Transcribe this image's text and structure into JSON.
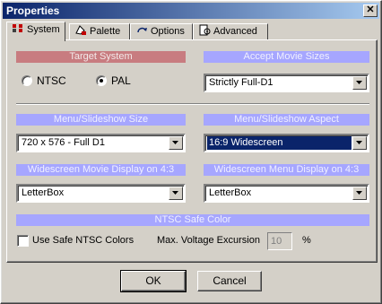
{
  "window": {
    "title": "Properties",
    "close_glyph": "✕"
  },
  "tabs": [
    {
      "label": "System",
      "icon": "system-icon",
      "active": true
    },
    {
      "label": "Palette",
      "icon": "palette-icon",
      "active": false
    },
    {
      "label": "Options",
      "icon": "options-icon",
      "active": false
    },
    {
      "label": "Advanced",
      "icon": "advanced-icon",
      "active": false
    }
  ],
  "target_system": {
    "header": "Target System",
    "ntsc_label": "NTSC",
    "pal_label": "PAL",
    "selected": "PAL"
  },
  "accept_movie_sizes": {
    "header": "Accept Movie Sizes",
    "value": "Strictly Full-D1"
  },
  "menu_size": {
    "header": "Menu/Slideshow Size",
    "value": "720 x 576 - Full D1"
  },
  "menu_aspect": {
    "header": "Menu/Slideshow Aspect",
    "value": "16:9 Widescreen"
  },
  "widescreen_movie": {
    "header": "Widescreen Movie Display on 4:3",
    "value": "LetterBox"
  },
  "widescreen_menu": {
    "header": "Widescreen Menu Display on 4:3",
    "value": "LetterBox"
  },
  "ntsc_safe": {
    "header": "NTSC Safe Color",
    "checkbox_label": "Use Safe NTSC Colors",
    "checked": false,
    "voltage_label": "Max. Voltage Excursion",
    "voltage_value": "10",
    "voltage_unit": "%"
  },
  "buttons": {
    "ok": "OK",
    "cancel": "Cancel"
  },
  "colors": {
    "title_start": "#0a246a",
    "title_end": "#a6caf0",
    "header_red": "#c87c80",
    "header_blue": "#a6a6ff",
    "selection": "#0a246a",
    "face": "#d4d0c8"
  }
}
